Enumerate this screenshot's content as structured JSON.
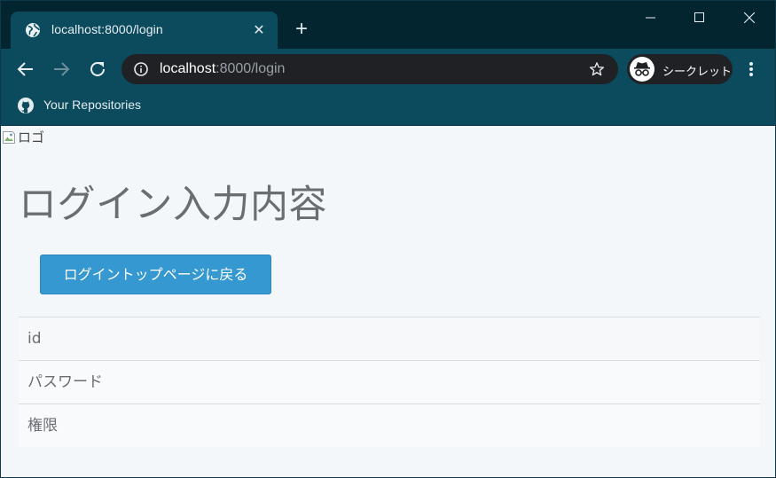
{
  "browser": {
    "tab": {
      "title": "localhost:8000/login",
      "favicon": "globe-icon"
    },
    "new_tab_symbol": "+",
    "omnibox": {
      "host": "localhost",
      "path": ":8000/login"
    },
    "profile": {
      "label": "シークレット",
      "icon": "incognito-icon"
    },
    "bookmarks": [
      {
        "label": "Your Repositories",
        "icon": "github-icon"
      }
    ],
    "colors": {
      "frame": "#02252f",
      "toolbar": "#0c4a5e",
      "omnibox": "#1f2124"
    }
  },
  "page": {
    "logo_alt": "ロゴ",
    "title": "ログイン入力内容",
    "back_button": "ログイントップページに戻る",
    "fields": [
      {
        "label": "id"
      },
      {
        "label": "パスワード"
      },
      {
        "label": "権限"
      }
    ],
    "colors": {
      "button": "#3598d0",
      "title_text": "#6a6e73",
      "background": "#f4f7fa"
    }
  }
}
